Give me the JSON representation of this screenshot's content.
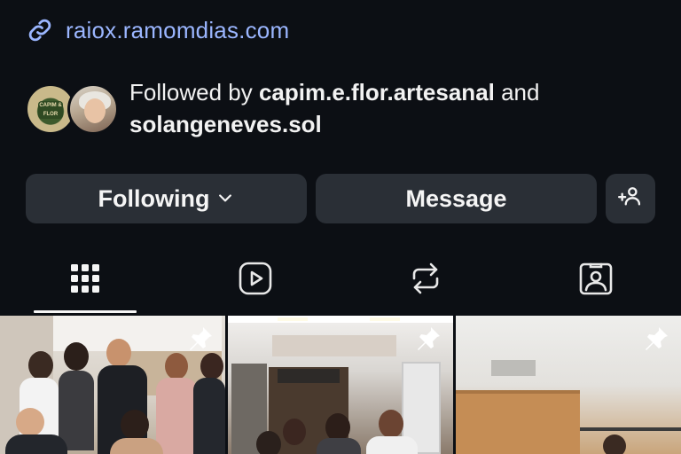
{
  "profile": {
    "link": "raiox.ramomdias.com",
    "followed_by_prefix": "Followed by ",
    "followed_by_user1": "capim.e.flor.artesanal",
    "followed_by_joiner": " and",
    "followed_by_user2": "solangeneves.sol",
    "avatar1_badge": "CAPIM & FLOR"
  },
  "actions": {
    "following_label": "Following",
    "message_label": "Message"
  },
  "tabs": [
    {
      "icon": "grid-icon",
      "selected": true
    },
    {
      "icon": "reels-icon",
      "selected": false
    },
    {
      "icon": "reposts-icon",
      "selected": false
    },
    {
      "icon": "tagged-icon",
      "selected": false
    }
  ],
  "posts": [
    {
      "pinned": true,
      "icon": "pin-icon"
    },
    {
      "pinned": true,
      "icon": "pin-icon"
    },
    {
      "pinned": true,
      "icon": "pin-icon"
    }
  ],
  "colors": {
    "background": "#0c0f14",
    "button": "#2a2f36",
    "link": "#9bb6ff"
  }
}
